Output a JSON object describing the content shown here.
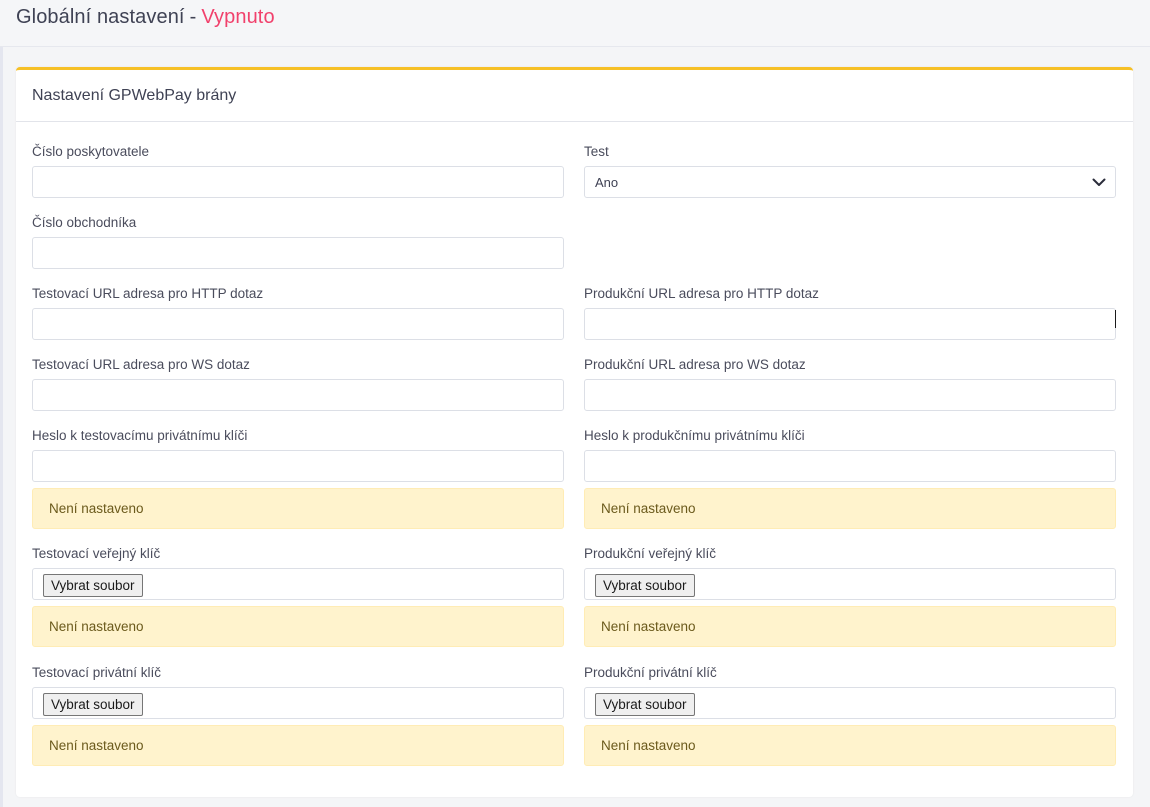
{
  "page": {
    "title": "Globální nastavení",
    "separator": "-",
    "status": "Vypnuto",
    "status_color": "#f1416c"
  },
  "card": {
    "title": "Nastavení GPWebPay brány",
    "accent_color": "#f6c026"
  },
  "fields": {
    "provider_number": {
      "label": "Číslo poskytovatele",
      "value": ""
    },
    "merchant_number": {
      "label": "Číslo obchodníka",
      "value": ""
    },
    "test": {
      "label": "Test",
      "value": "Ano",
      "options": [
        "Ano"
      ]
    },
    "test_http_url": {
      "label": "Testovací URL adresa pro HTTP dotaz",
      "value": ""
    },
    "prod_http_url": {
      "label": "Produkční URL adresa pro HTTP dotaz",
      "value": ""
    },
    "test_ws_url": {
      "label": "Testovací URL adresa pro WS dotaz",
      "value": ""
    },
    "prod_ws_url": {
      "label": "Produkční URL adresa pro WS dotaz",
      "value": ""
    },
    "test_private_key_password": {
      "label": "Heslo k testovacímu privátnímu klíči",
      "value": "",
      "notice": "Není nastaveno"
    },
    "prod_private_key_password": {
      "label": "Heslo k produkčnímu privátnímu klíči",
      "value": "",
      "notice": "Není nastaveno"
    },
    "test_public_key": {
      "label": "Testovací veřejný klíč",
      "button": "Vybrat soubor",
      "notice": "Není nastaveno"
    },
    "prod_public_key": {
      "label": "Produkční veřejný klíč",
      "button": "Vybrat soubor",
      "notice": "Není nastaveno"
    },
    "test_private_key": {
      "label": "Testovací privátní klíč",
      "button": "Vybrat soubor",
      "notice": "Není nastaveno"
    },
    "prod_private_key": {
      "label": "Produkční privátní klíč",
      "button": "Vybrat soubor",
      "notice": "Není nastaveno"
    }
  },
  "icons": {
    "select_arrow": "chevron-down-icon"
  }
}
